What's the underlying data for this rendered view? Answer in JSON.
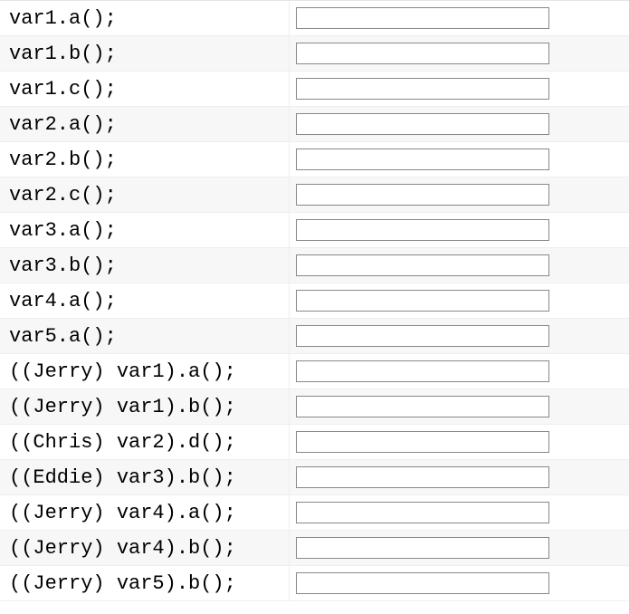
{
  "rows": [
    {
      "label": "var1.a();",
      "value": ""
    },
    {
      "label": "var1.b();",
      "value": ""
    },
    {
      "label": "var1.c();",
      "value": ""
    },
    {
      "label": "var2.a();",
      "value": ""
    },
    {
      "label": "var2.b();",
      "value": ""
    },
    {
      "label": "var2.c();",
      "value": ""
    },
    {
      "label": "var3.a();",
      "value": ""
    },
    {
      "label": "var3.b();",
      "value": ""
    },
    {
      "label": "var4.a();",
      "value": ""
    },
    {
      "label": "var5.a();",
      "value": ""
    },
    {
      "label": "((Jerry) var1).a();",
      "value": ""
    },
    {
      "label": "((Jerry) var1).b();",
      "value": ""
    },
    {
      "label": "((Chris) var2).d();",
      "value": ""
    },
    {
      "label": "((Eddie) var3).b();",
      "value": ""
    },
    {
      "label": "((Jerry) var4).a();",
      "value": ""
    },
    {
      "label": "((Jerry) var4).b();",
      "value": ""
    },
    {
      "label": "((Jerry) var5).b();",
      "value": ""
    }
  ]
}
